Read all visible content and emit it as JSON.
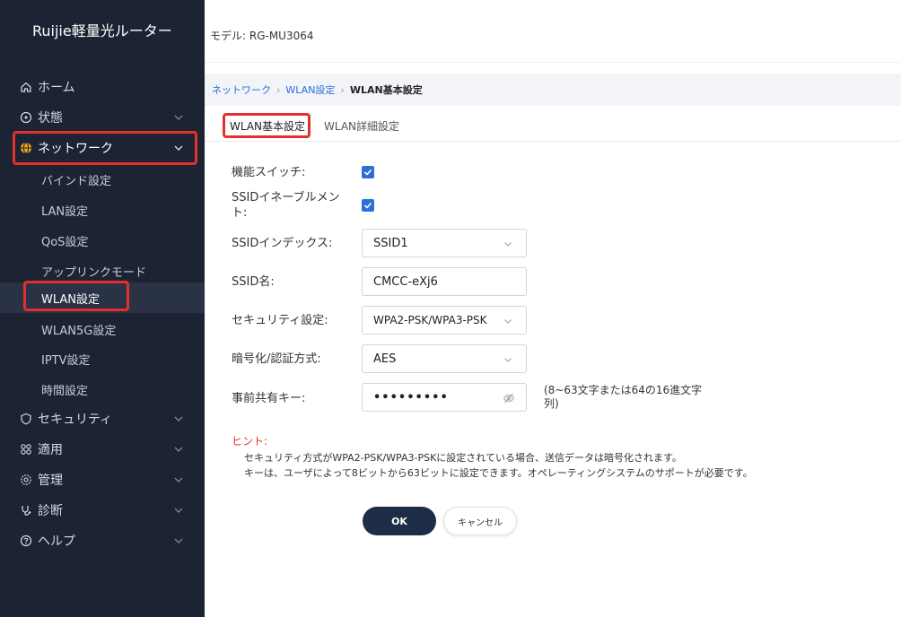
{
  "sidebar": {
    "brand": "Ruijie軽量光ルーター",
    "menu": [
      {
        "label": "ホーム",
        "icon": "home-icon"
      },
      {
        "label": "状態",
        "icon": "status-icon"
      },
      {
        "label": "ネットワーク",
        "icon": "globe-icon"
      },
      {
        "label": "セキュリティ",
        "icon": "shield-icon"
      },
      {
        "label": "適用",
        "icon": "apps-icon"
      },
      {
        "label": "管理",
        "icon": "gear-icon"
      },
      {
        "label": "診断",
        "icon": "stethoscope-icon"
      },
      {
        "label": "ヘルプ",
        "icon": "help-icon"
      }
    ],
    "network_sub": [
      {
        "label": "バインド設定"
      },
      {
        "label": "LAN設定"
      },
      {
        "label": "QoS設定"
      },
      {
        "label": "アップリンクモード"
      },
      {
        "label": "WLAN設定"
      },
      {
        "label": "WLAN5G設定"
      },
      {
        "label": "IPTV設定"
      },
      {
        "label": "時間設定"
      }
    ]
  },
  "header": {
    "model": "モデル:  RG-MU3064"
  },
  "breadcrumb": {
    "items": [
      "ネットワーク",
      "WLAN設定",
      "WLAN基本設定"
    ],
    "separator": "›"
  },
  "tabs": [
    {
      "label": "WLAN基本設定",
      "active": true
    },
    {
      "label": "WLAN詳細設定",
      "active": false
    }
  ],
  "form": {
    "function_switch": {
      "label": "機能スイッチ:",
      "checked": true
    },
    "ssid_enable": {
      "label_line1": "SSIDイネーブルメン",
      "label_line2": "ト:",
      "checked": true
    },
    "ssid_index": {
      "label": "SSIDインデックス:",
      "value": "SSID1"
    },
    "ssid_name": {
      "label": "SSID名:",
      "value": "CMCC-eXj6"
    },
    "security": {
      "label": "セキュリティ設定:",
      "value": "WPA2-PSK/WPA3-PSK"
    },
    "encryption": {
      "label": "暗号化/認証方式:",
      "value": "AES"
    },
    "psk": {
      "label": "事前共有キー:",
      "value": "•••••••••",
      "note_line1": "(8~63文字または64の16進文字",
      "note_line2": "列)"
    }
  },
  "hint": {
    "title": "ヒント:",
    "lines": [
      "セキュリティ方式がWPA2-PSK/WPA3-PSKに設定されている場合、送信データは暗号化されます。",
      "キーは、ユーザによって8ビットから63ビットに設定できます。オペレーティングシステムのサポートが必要です。"
    ]
  },
  "buttons": {
    "ok": "OK",
    "cancel": "キャンセル"
  },
  "colors": {
    "sidebar_bg": "#1c2333",
    "accent": "#2d6fd8",
    "highlight": "#e2302e",
    "ok_button": "#1e2d47"
  }
}
